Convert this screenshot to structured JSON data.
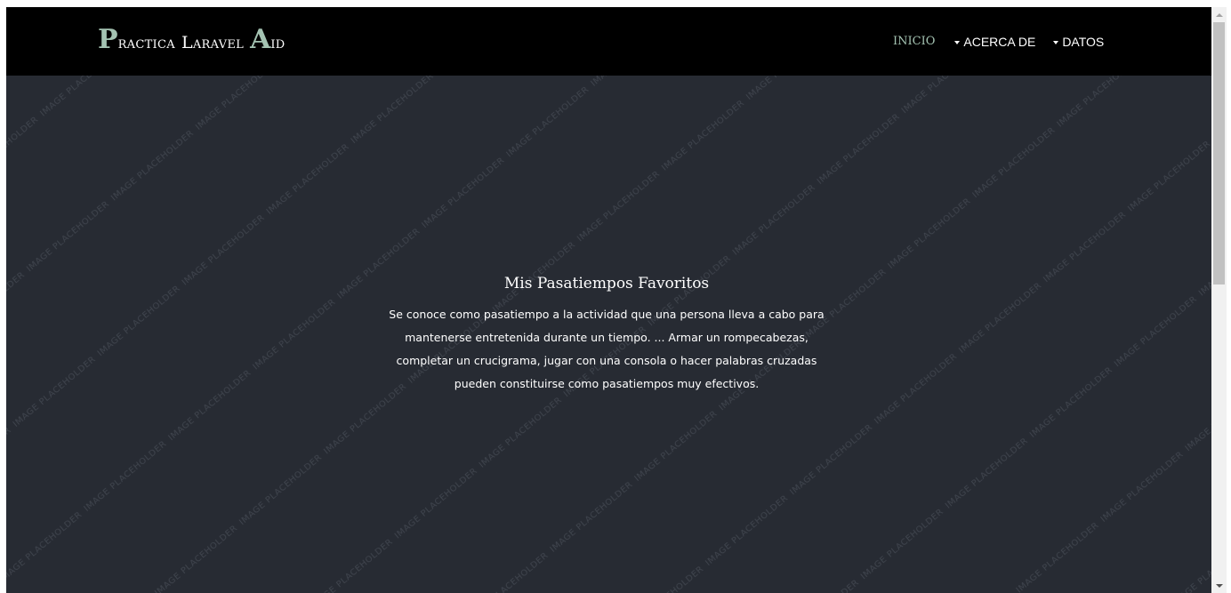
{
  "navbar": {
    "brand": {
      "initial_1": "P",
      "word_1": "ractica",
      "word_2": "Laravel",
      "initial_2": "A",
      "word_3": "id"
    },
    "links": {
      "inicio": "INICIO",
      "acerca": "ACERCA DE",
      "datos": "DATOS"
    },
    "colors": {
      "background": "#000000",
      "accent": "#a4c3b2",
      "text": "#ffffff"
    }
  },
  "hero": {
    "watermark": "IMAGE PLACEHOLDER",
    "title": "Mis Pasatiempos Favoritos",
    "text_lines": [
      "Se conoce como pasatiempo a la actividad que una persona lleva a cabo para",
      "mantenerse entretenida durante un tiempo. ... Armar un rompecabezas,",
      "completar un crucigrama, jugar con una consola o hacer palabras cruzadas",
      "pueden constituirse como pasatiempos muy efectivos."
    ],
    "background_color": "#272b33"
  },
  "icons": {
    "dropdown": "caret-down-icon",
    "scroll_up": "scroll-up-arrow-icon",
    "scroll_down": "scroll-down-arrow-icon"
  }
}
